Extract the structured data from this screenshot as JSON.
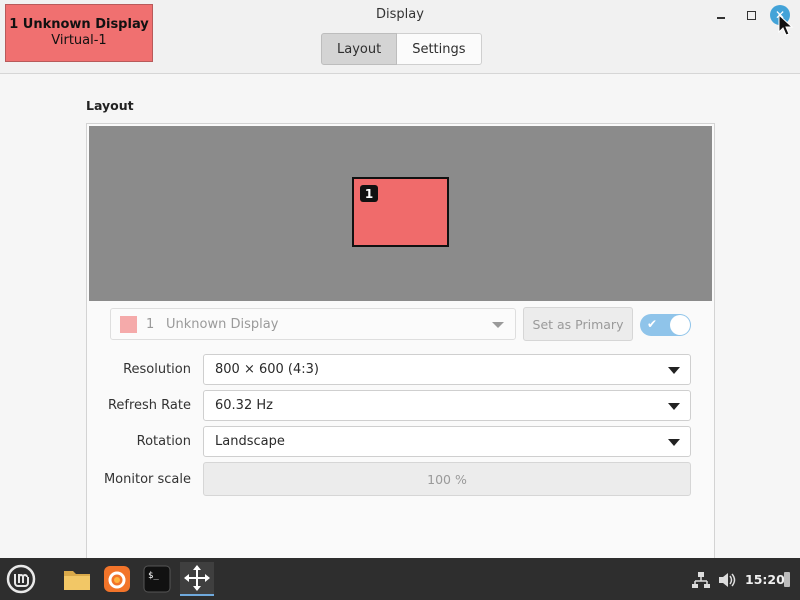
{
  "window": {
    "title": "Display",
    "tabs": [
      {
        "label": "Layout",
        "active": true
      },
      {
        "label": "Settings",
        "active": false
      }
    ],
    "monitor_badge": {
      "line1": "1  Unknown Display",
      "line2": "Virtual-1"
    }
  },
  "layout": {
    "section_title": "Layout",
    "canvas": {
      "background": "#8b8b8b",
      "monitor": {
        "number": "1",
        "color": "#f06b6b"
      }
    },
    "display_select": {
      "number": "1",
      "name": "Unknown Display",
      "swatch_color": "#f5aaaa"
    },
    "set_primary_label": "Set as Primary",
    "enabled": true
  },
  "settings": {
    "resolution": {
      "label": "Resolution",
      "value": "800 × 600 (4:3)"
    },
    "refresh_rate": {
      "label": "Refresh Rate",
      "value": "60.32 Hz"
    },
    "rotation": {
      "label": "Rotation",
      "value": "Landscape"
    },
    "monitor_scale": {
      "label": "Monitor scale",
      "value": "100 %"
    }
  },
  "taskbar": {
    "apps": [
      {
        "icon": "linux-mint-menu-icon"
      },
      {
        "icon": "folder-icon"
      },
      {
        "icon": "firefox-icon"
      },
      {
        "icon": "terminal-icon"
      },
      {
        "icon": "display-settings-icon",
        "active": true
      }
    ],
    "clock": "15:20",
    "accent": "#6fa9dc"
  }
}
